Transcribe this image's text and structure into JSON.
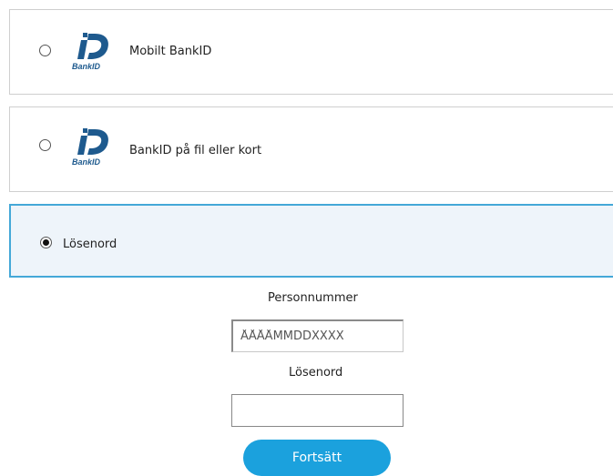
{
  "login_options": [
    {
      "label": "Mobilt BankID",
      "icon": "bankid-logo",
      "selected": false
    },
    {
      "label": "BankID på fil eller kort",
      "icon": "bankid-logo",
      "selected": false
    },
    {
      "label": "Lösenord",
      "icon": null,
      "selected": true
    }
  ],
  "bankid_logo_text": "BankID",
  "form": {
    "personal_number_label": "Personnummer",
    "personal_number_placeholder": "ÅÅÅÅMMDDXXXX",
    "personal_number_value": "",
    "password_label": "Lösenord",
    "password_value": "",
    "continue_label": "Fortsätt"
  },
  "colors": {
    "selected_border": "#44a8d8",
    "selected_background": "#eef4fa",
    "button": "#1ba1dd",
    "logo_blue": "#1e5a8e"
  }
}
